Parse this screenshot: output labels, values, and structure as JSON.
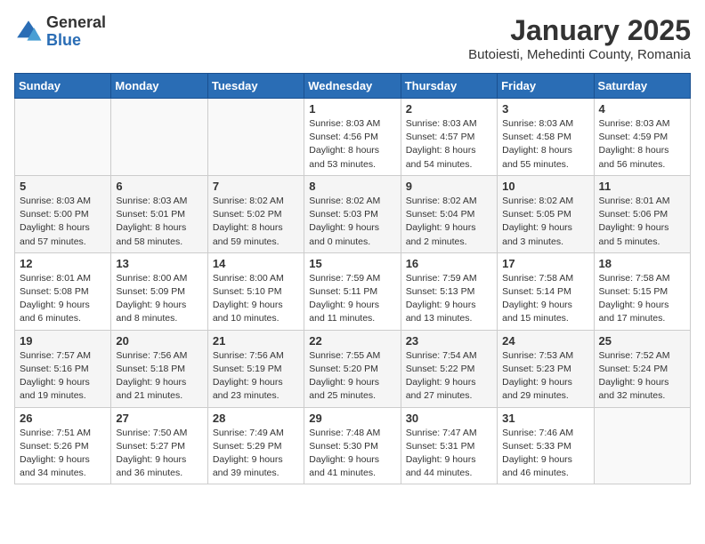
{
  "logo": {
    "general": "General",
    "blue": "Blue"
  },
  "title": "January 2025",
  "subtitle": "Butoiesti, Mehedinti County, Romania",
  "days_of_week": [
    "Sunday",
    "Monday",
    "Tuesday",
    "Wednesday",
    "Thursday",
    "Friday",
    "Saturday"
  ],
  "weeks": [
    [
      {
        "day": "",
        "info": ""
      },
      {
        "day": "",
        "info": ""
      },
      {
        "day": "",
        "info": ""
      },
      {
        "day": "1",
        "info": "Sunrise: 8:03 AM\nSunset: 4:56 PM\nDaylight: 8 hours and 53 minutes."
      },
      {
        "day": "2",
        "info": "Sunrise: 8:03 AM\nSunset: 4:57 PM\nDaylight: 8 hours and 54 minutes."
      },
      {
        "day": "3",
        "info": "Sunrise: 8:03 AM\nSunset: 4:58 PM\nDaylight: 8 hours and 55 minutes."
      },
      {
        "day": "4",
        "info": "Sunrise: 8:03 AM\nSunset: 4:59 PM\nDaylight: 8 hours and 56 minutes."
      }
    ],
    [
      {
        "day": "5",
        "info": "Sunrise: 8:03 AM\nSunset: 5:00 PM\nDaylight: 8 hours and 57 minutes."
      },
      {
        "day": "6",
        "info": "Sunrise: 8:03 AM\nSunset: 5:01 PM\nDaylight: 8 hours and 58 minutes."
      },
      {
        "day": "7",
        "info": "Sunrise: 8:02 AM\nSunset: 5:02 PM\nDaylight: 8 hours and 59 minutes."
      },
      {
        "day": "8",
        "info": "Sunrise: 8:02 AM\nSunset: 5:03 PM\nDaylight: 9 hours and 0 minutes."
      },
      {
        "day": "9",
        "info": "Sunrise: 8:02 AM\nSunset: 5:04 PM\nDaylight: 9 hours and 2 minutes."
      },
      {
        "day": "10",
        "info": "Sunrise: 8:02 AM\nSunset: 5:05 PM\nDaylight: 9 hours and 3 minutes."
      },
      {
        "day": "11",
        "info": "Sunrise: 8:01 AM\nSunset: 5:06 PM\nDaylight: 9 hours and 5 minutes."
      }
    ],
    [
      {
        "day": "12",
        "info": "Sunrise: 8:01 AM\nSunset: 5:08 PM\nDaylight: 9 hours and 6 minutes."
      },
      {
        "day": "13",
        "info": "Sunrise: 8:00 AM\nSunset: 5:09 PM\nDaylight: 9 hours and 8 minutes."
      },
      {
        "day": "14",
        "info": "Sunrise: 8:00 AM\nSunset: 5:10 PM\nDaylight: 9 hours and 10 minutes."
      },
      {
        "day": "15",
        "info": "Sunrise: 7:59 AM\nSunset: 5:11 PM\nDaylight: 9 hours and 11 minutes."
      },
      {
        "day": "16",
        "info": "Sunrise: 7:59 AM\nSunset: 5:13 PM\nDaylight: 9 hours and 13 minutes."
      },
      {
        "day": "17",
        "info": "Sunrise: 7:58 AM\nSunset: 5:14 PM\nDaylight: 9 hours and 15 minutes."
      },
      {
        "day": "18",
        "info": "Sunrise: 7:58 AM\nSunset: 5:15 PM\nDaylight: 9 hours and 17 minutes."
      }
    ],
    [
      {
        "day": "19",
        "info": "Sunrise: 7:57 AM\nSunset: 5:16 PM\nDaylight: 9 hours and 19 minutes."
      },
      {
        "day": "20",
        "info": "Sunrise: 7:56 AM\nSunset: 5:18 PM\nDaylight: 9 hours and 21 minutes."
      },
      {
        "day": "21",
        "info": "Sunrise: 7:56 AM\nSunset: 5:19 PM\nDaylight: 9 hours and 23 minutes."
      },
      {
        "day": "22",
        "info": "Sunrise: 7:55 AM\nSunset: 5:20 PM\nDaylight: 9 hours and 25 minutes."
      },
      {
        "day": "23",
        "info": "Sunrise: 7:54 AM\nSunset: 5:22 PM\nDaylight: 9 hours and 27 minutes."
      },
      {
        "day": "24",
        "info": "Sunrise: 7:53 AM\nSunset: 5:23 PM\nDaylight: 9 hours and 29 minutes."
      },
      {
        "day": "25",
        "info": "Sunrise: 7:52 AM\nSunset: 5:24 PM\nDaylight: 9 hours and 32 minutes."
      }
    ],
    [
      {
        "day": "26",
        "info": "Sunrise: 7:51 AM\nSunset: 5:26 PM\nDaylight: 9 hours and 34 minutes."
      },
      {
        "day": "27",
        "info": "Sunrise: 7:50 AM\nSunset: 5:27 PM\nDaylight: 9 hours and 36 minutes."
      },
      {
        "day": "28",
        "info": "Sunrise: 7:49 AM\nSunset: 5:29 PM\nDaylight: 9 hours and 39 minutes."
      },
      {
        "day": "29",
        "info": "Sunrise: 7:48 AM\nSunset: 5:30 PM\nDaylight: 9 hours and 41 minutes."
      },
      {
        "day": "30",
        "info": "Sunrise: 7:47 AM\nSunset: 5:31 PM\nDaylight: 9 hours and 44 minutes."
      },
      {
        "day": "31",
        "info": "Sunrise: 7:46 AM\nSunset: 5:33 PM\nDaylight: 9 hours and 46 minutes."
      },
      {
        "day": "",
        "info": ""
      }
    ]
  ]
}
